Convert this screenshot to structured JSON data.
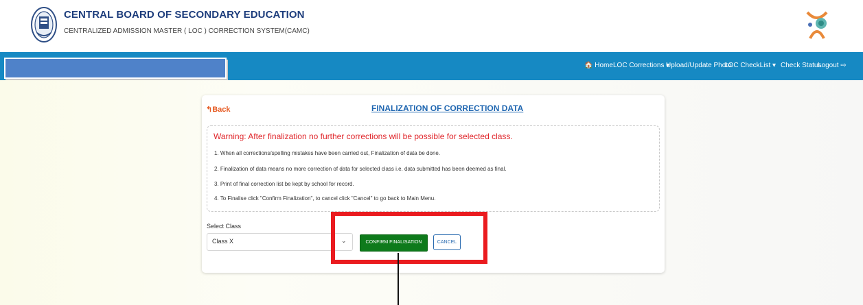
{
  "header": {
    "title": "CENTRAL BOARD OF SECONDARY EDUCATION",
    "subtitle": "CENTRALIZED ADMISSION MASTER ( LOC ) CORRECTION SYSTEM(CAMC)"
  },
  "nav": {
    "home": "🏠 Home",
    "loc_corrections": "LOC Corrections ▾",
    "upload_photo": "Upload/Update Photo",
    "loc_checklist": "LOC CheckList ▾",
    "check_status": "Check Status",
    "logout": "Logout ⇨"
  },
  "card": {
    "back": "↰Back",
    "title": "FINALIZATION OF CORRECTION DATA",
    "warning": "Warning: After finalization no further corrections will be possible for selected class.",
    "instructions": [
      "1. When all corrections/spelling mistakes have been carried out, Finalization of data be done.",
      "2. Finalization of data means no more correction of data for selected class i.e. data submitted has been deemed as final.",
      "3. Print of final correction list be kept by school for record.",
      "4. To Finalise click \"Confirm Finalization\", to cancel click \"Cancel\" to go back to Main Menu."
    ],
    "select_label": "Select Class",
    "select_value": "Class X",
    "confirm_button": "CONFIRM FINALISATION",
    "cancel_button": "CANCEL"
  },
  "colors": {
    "navbar": "#1689c3",
    "confirm": "#0e7a1b",
    "highlight": "#ea1b1f",
    "warning": "#e0262b"
  }
}
